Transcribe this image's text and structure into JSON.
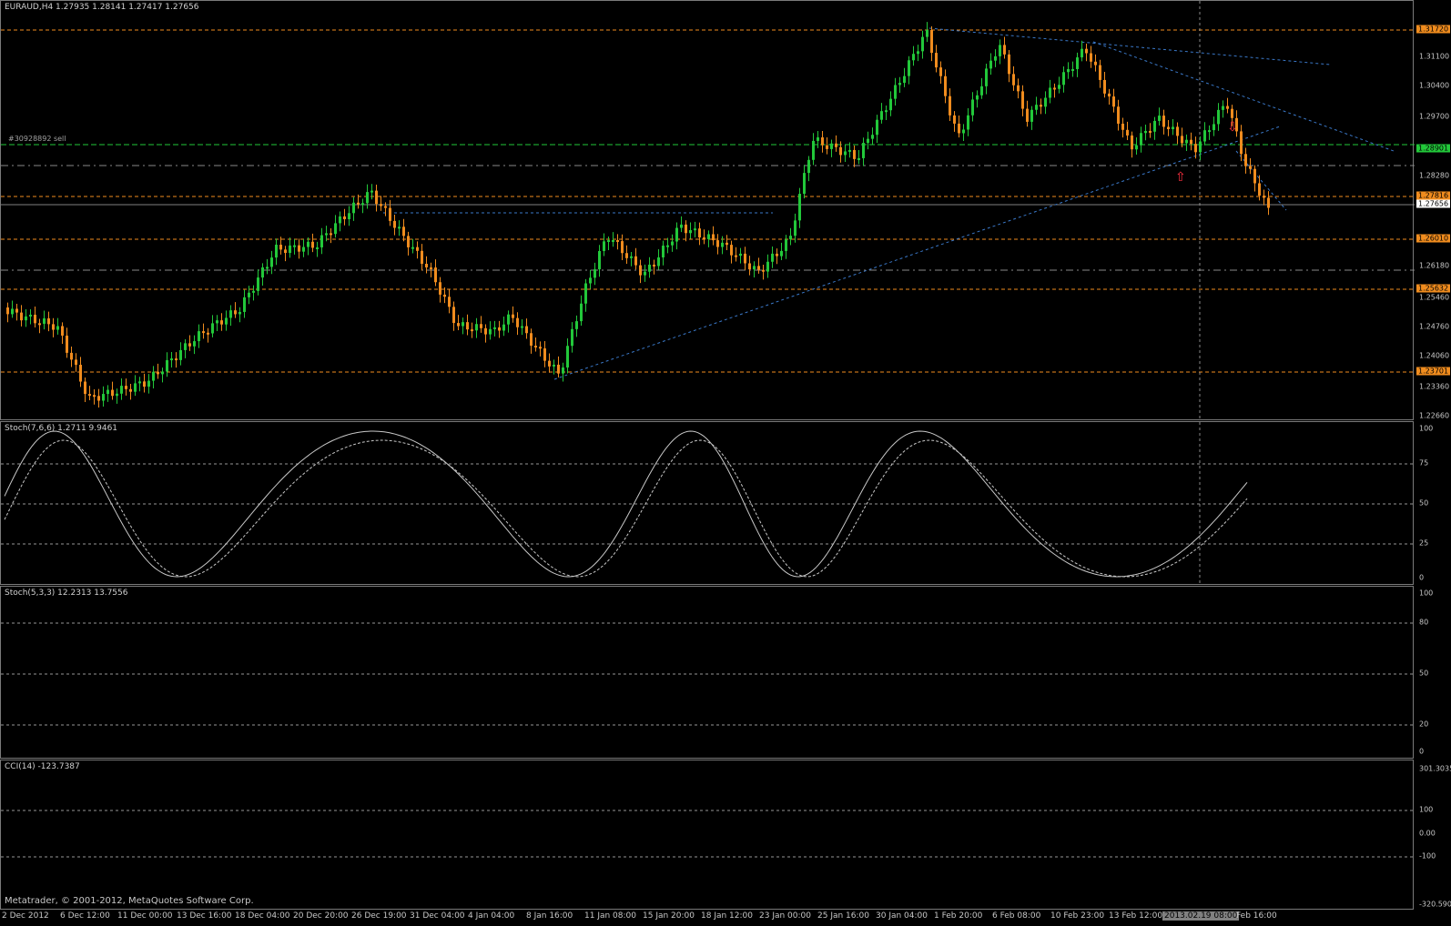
{
  "chart": {
    "header": "EURAUD,H4  1.27935 1.28141 1.27417 1.27656",
    "order_label": "#30928892 sell",
    "price_ticks": [
      "1.31100",
      "1.30400",
      "1.29700",
      "1.28280",
      "1.26180",
      "1.25460",
      "1.24760",
      "1.24060",
      "1.23360",
      "1.22660"
    ],
    "level_tags": [
      {
        "text": "1.31720",
        "color": "orange"
      },
      {
        "text": "1.28901",
        "color": "green"
      },
      {
        "text": "1.27816",
        "color": "orange"
      },
      {
        "text": "1.27656",
        "color": "white"
      },
      {
        "text": "1.26010",
        "color": "orange"
      },
      {
        "text": "1.25632",
        "color": "orange"
      },
      {
        "text": "1.23701",
        "color": "orange"
      }
    ]
  },
  "stoch1": {
    "label": "Stoch(7,6,6) 1.2711 9.9461",
    "ticks": [
      "100",
      "75",
      "50",
      "25",
      "0"
    ]
  },
  "stoch2": {
    "label": "Stoch(5,3,3) 12.2313 13.7556",
    "ticks": [
      "100",
      "80",
      "50",
      "20",
      "0"
    ]
  },
  "cci": {
    "label": "CCI(14) -123.7387",
    "ticks": [
      "301.3035",
      "100",
      "0.00",
      "-100",
      "-320.590"
    ]
  },
  "time_axis": [
    "2 Dec 2012",
    "6 Dec 12:00",
    "11 Dec 00:00",
    "13 Dec 16:00",
    "18 Dec 04:00",
    "20 Dec 20:00",
    "26 Dec 19:00",
    "31 Dec 04:00",
    "4 Jan 04:00",
    "8 Jan 16:00",
    "11 Jan 08:00",
    "15 Jan 20:00",
    "18 Jan 12:00",
    "23 Jan 00:00",
    "25 Jan 16:00",
    "30 Jan 04:00",
    "1 Feb 20:00",
    "6 Feb 08:00",
    "10 Feb 23:00",
    "13 Feb 12:00",
    "2013.02.19 08:00",
    "Feb 16:00"
  ],
  "footer": "Metatrader, © 2001-2012, MetaQuotes Software Corp.",
  "colors": {
    "bull": "#22c83a",
    "bear": "#f08c1e",
    "trend": "#3a78c8",
    "grid": "#c8c8c8"
  }
}
